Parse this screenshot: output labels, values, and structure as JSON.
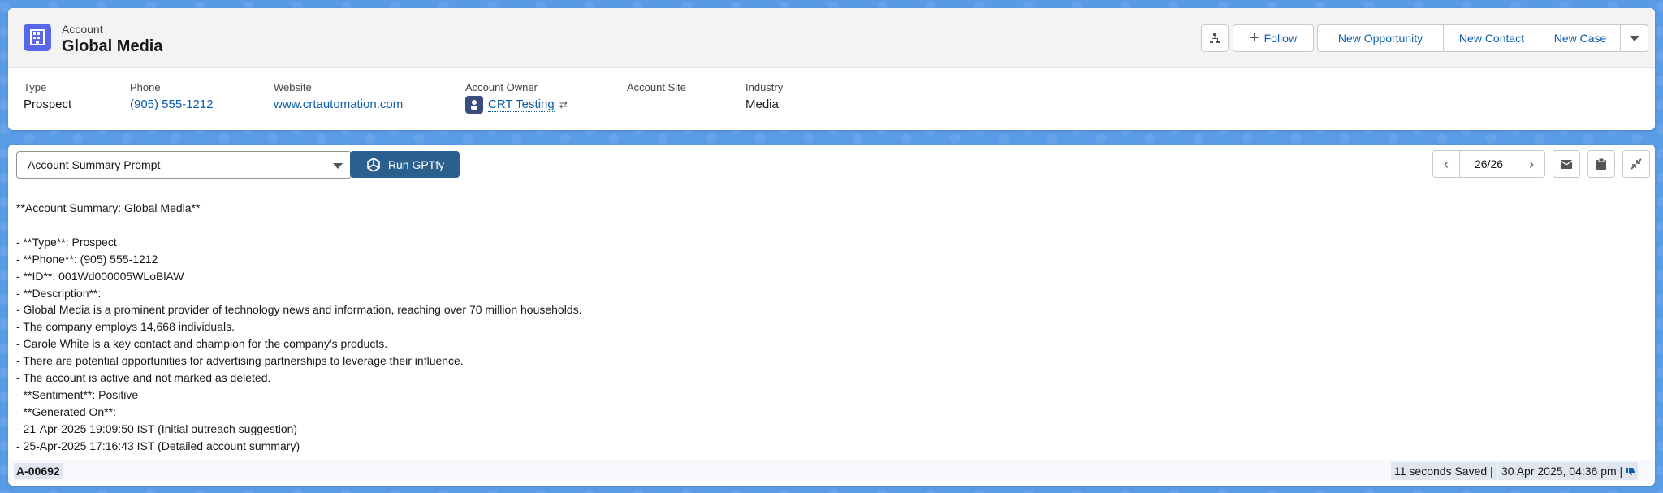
{
  "header": {
    "object_type": "Account",
    "record_name": "Global Media",
    "buttons": {
      "follow": "Follow",
      "new_opportunity": "New Opportunity",
      "new_contact": "New Contact",
      "new_case": "New Case"
    },
    "fields": [
      {
        "label": "Type",
        "value": "Prospect"
      },
      {
        "label": "Phone",
        "value": "(905) 555-1212"
      },
      {
        "label": "Website",
        "value": "www.crtautomation.com"
      },
      {
        "label": "Account Owner",
        "value": "CRT Testing"
      },
      {
        "label": "Account Site",
        "value": ""
      },
      {
        "label": "Industry",
        "value": "Media"
      }
    ]
  },
  "gptfy": {
    "prompt_select": "Account Summary Prompt",
    "run_label": "Run GPTfy",
    "pager": "26/26",
    "output_lines": [
      "**Account Summary: Global Media**",
      "",
      "- **Type**: Prospect",
      "- **Phone**: (905) 555-1212",
      "- **ID**: 001Wd000005WLoBlAW",
      "- **Description**:",
      "- Global Media is a prominent provider of technology news and information, reaching over 70 million households.",
      "- The company employs 14,668 individuals.",
      "- Carole White is a key contact and champion for the company's products.",
      "- There are potential opportunities for advertising partnerships to leverage their influence.",
      "- The account is active and not marked as deleted.",
      "- **Sentiment**: Positive",
      "- **Generated On**:",
      "- 21-Apr-2025 19:09:50 IST (Initial outreach suggestion)",
      "- 25-Apr-2025 17:16:43 IST (Detailed account summary)"
    ],
    "footer": {
      "record_id": "A-00692",
      "saved_status": "11 seconds Saved |",
      "timestamp": "30 Apr 2025, 04:36 pm |"
    }
  },
  "colors": {
    "brand_blue": "#0b5cab",
    "account_icon": "#5867e8",
    "run_button": "#2b5f8e",
    "background": "#5a9be6"
  }
}
